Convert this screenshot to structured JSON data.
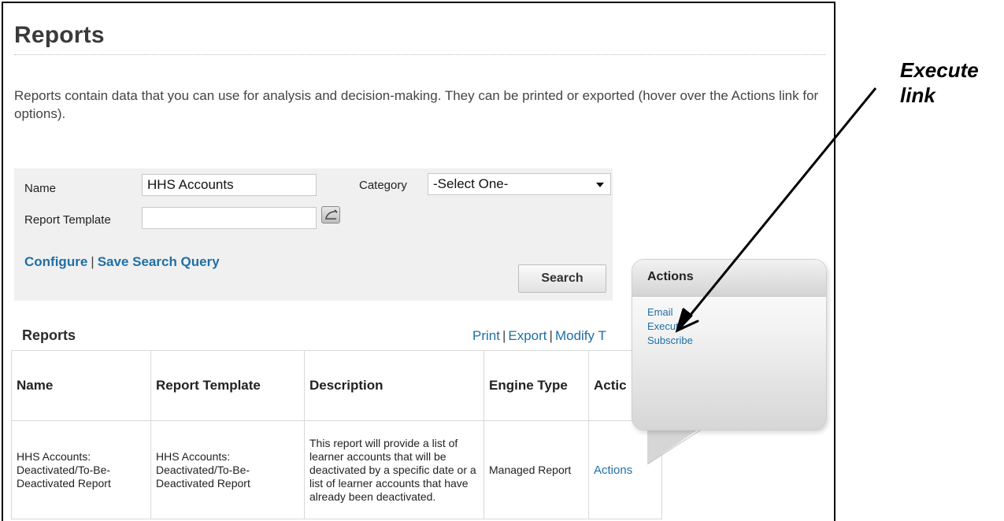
{
  "page": {
    "title": "Reports",
    "intro": "Reports contain data that you can use for analysis and decision-making. They can be printed or exported (hover over the Actions link for options)."
  },
  "search": {
    "name_label": "Name",
    "name_value": "HHS Accounts",
    "category_label": "Category",
    "category_value": "-Select One-",
    "template_label": "Report Template",
    "template_value": "",
    "configure_link": "Configure",
    "separator": "|",
    "save_query_link": "Save Search Query",
    "search_button": "Search"
  },
  "results": {
    "heading": "Reports",
    "links": [
      "Print",
      "Export",
      "Modify T"
    ],
    "columns": [
      "Name",
      "Report Template",
      "Description",
      "Engine Type",
      "Actic"
    ],
    "rows": [
      {
        "name": "HHS Accounts: Deactivated/To-Be-Deactivated Report",
        "template": "HHS Accounts: Deactivated/To-Be-Deactivated Report",
        "description": "This report will provide a list of learner accounts that will be deactivated by a specific date or a list of learner accounts that have already been deactivated.",
        "engine": "Managed Report",
        "action": "Actions"
      }
    ]
  },
  "popup": {
    "title": "Actions",
    "items": [
      "Email",
      "Execute",
      "Subscribe"
    ]
  },
  "annotation": {
    "line1": "Execute",
    "line2": "link"
  },
  "colors": {
    "link": "#1f6fa5",
    "panel": "#f0f0f0"
  },
  "icons": {
    "template_picker": "picker-icon",
    "category_caret": "chevron-down-icon"
  }
}
